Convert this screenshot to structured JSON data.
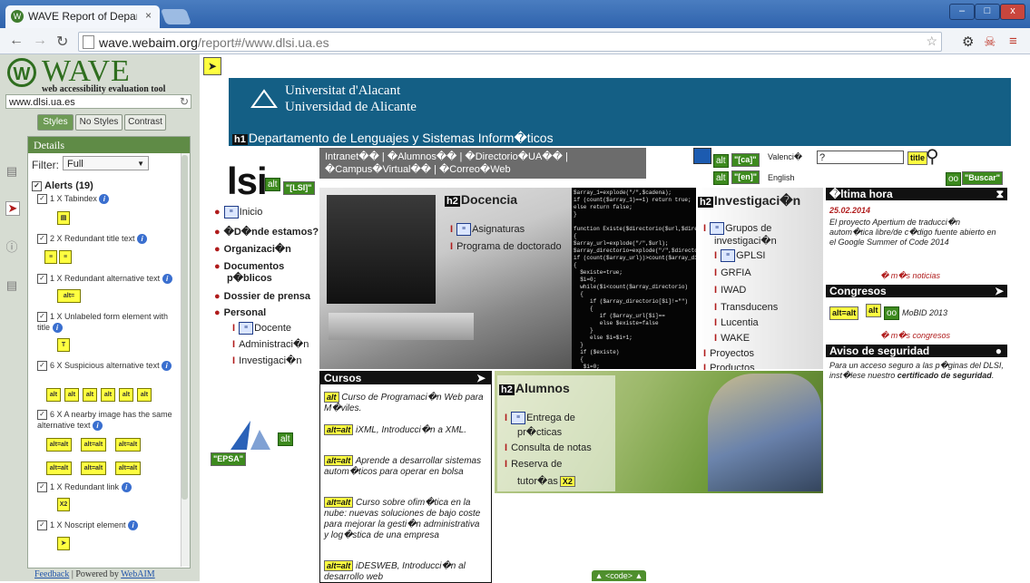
{
  "browser": {
    "tab_title": "WAVE Report of Departamer",
    "tab_close": "×",
    "url_host": "wave.webaim.org",
    "url_path": "/report#/www.dlsi.ua.es",
    "win_min": "–",
    "win_max": "□",
    "win_close": "x"
  },
  "wave": {
    "logo_text": "WAVE",
    "tagline": "web accessibility evaluation tool",
    "url_value": "www.dlsi.ua.es",
    "tabs": [
      "Styles",
      "No Styles",
      "Contrast"
    ],
    "details_title": "Details",
    "filter_label": "Filter:",
    "filter_value": "Full",
    "alerts_title": "Alerts (19)",
    "alerts": [
      {
        "label": "1 X Tabindex"
      },
      {
        "label": "2 X Redundant title text"
      },
      {
        "label": "1 X Redundant alternative text"
      },
      {
        "label": "1 X Unlabeled form element with title"
      },
      {
        "label": "6 X Suspicious alternative text"
      },
      {
        "label": "6 X A nearby image has the same alternative text"
      },
      {
        "label": "1 X Redundant link"
      },
      {
        "label": "1 X Noscript element"
      }
    ],
    "feedback": "Feedback",
    "powered": "| Powered by",
    "webaim": "WebAIM",
    "code_button": "▲ <code> ▲"
  },
  "site": {
    "university_ca": "Universitat d'Alacant",
    "university_es": "Universidad de Alicante",
    "dept_heading": "Departamento de Lenguajes y Sistemas Inform�ticos",
    "top_links_1": "Intranet�� | �Alumnos�� | �Directorio�UA�� |",
    "top_links_2": "�Campus�Virtual�� | �Correo�Web",
    "lang_valencia": "Valenci�",
    "lang_english": "English",
    "lang_ca": "\"[ca]\"",
    "lang_en": "\"[en]\"",
    "search_value": "?",
    "search_button": "\"Buscar\"",
    "lsi_alt": "\"[LSI]\"",
    "lsi_text": "lsi",
    "nav": [
      "Inicio",
      "�D�nde estamos?",
      "Organizaci�n",
      "Documentos",
      "p�blicos",
      "Dossier de prensa",
      "Personal"
    ],
    "personal_sub": [
      "Docente",
      "Administraci�n",
      "Investigaci�n"
    ],
    "epsa_alt": "\"EPSA\"",
    "docencia": {
      "title": "Docencia",
      "items": [
        "Asignaturas",
        "Programa de doctorado"
      ]
    },
    "investigacion": {
      "title": "Investigaci�n",
      "items": [
        "Grupos de",
        "investigaci�n",
        "GPLSI",
        "GRFIA",
        "IWAD",
        "Transducens",
        "Lucentia",
        "WAKE",
        "Proyectos",
        "Productos"
      ]
    },
    "ultima": {
      "title": "�ltima hora",
      "date": "25.02.2014",
      "text": "El proyecto Apertium de traducci�n autom�tica libre/de c�digo fuente abierto en el Google Summer of Code 2014",
      "more": "� m�s noticias"
    },
    "congresos": {
      "title": "Congresos",
      "item": "MoBID 2013",
      "more": "� m�s congresos"
    },
    "aviso": {
      "title": "Aviso de seguridad",
      "text1": "Para un acceso seguro a las p�ginas del DLSI, inst�lese nuestro",
      "text_bold": "certificado de seguridad",
      "text2": "."
    },
    "cursos": {
      "title": "Cursos",
      "items": [
        "Curso de Programaci�n Web para M�viles.",
        "iXML, Introducci�n a XML.",
        "Aprende a desarrollar sistemas autom�ticos para operar en bolsa",
        "Curso sobre ofim�tica en la nube: nuevas soluciones de bajo coste para mejorar la gesti�n administrativa y log�stica de una empresa",
        "iDESWEB, Introducci�n al desarrollo web"
      ]
    },
    "alumnos": {
      "title": "Alumnos",
      "items": [
        "Entrega de",
        "pr�cticas",
        "Consulta de notas",
        "Reserva de",
        "tutor�as"
      ]
    }
  },
  "code_lines": "$array_1=explode(\"/\",$cadena);\nif (count($array_1)==1) return true;\nelse return false;\n}\n\nfunction Existe($directorio($url,$dire\n{\n$array_url=explode(\"/\",$url);\n$array_directorio=explode(\"/\",$directo\nif (count($array_url))>count($array_di\n{\n  $existe=true;\n  $i=0;\n  while($i<count($array_directorio)\n  {\n     if ($array_directorio[$i]!=\"\")\n     {\n        if ($array_url[$i]==\n        else $existe=false\n     }\n     else $i=$i+1;\n  }\n  if ($existe)\n  {\n   $i=0;"
}
